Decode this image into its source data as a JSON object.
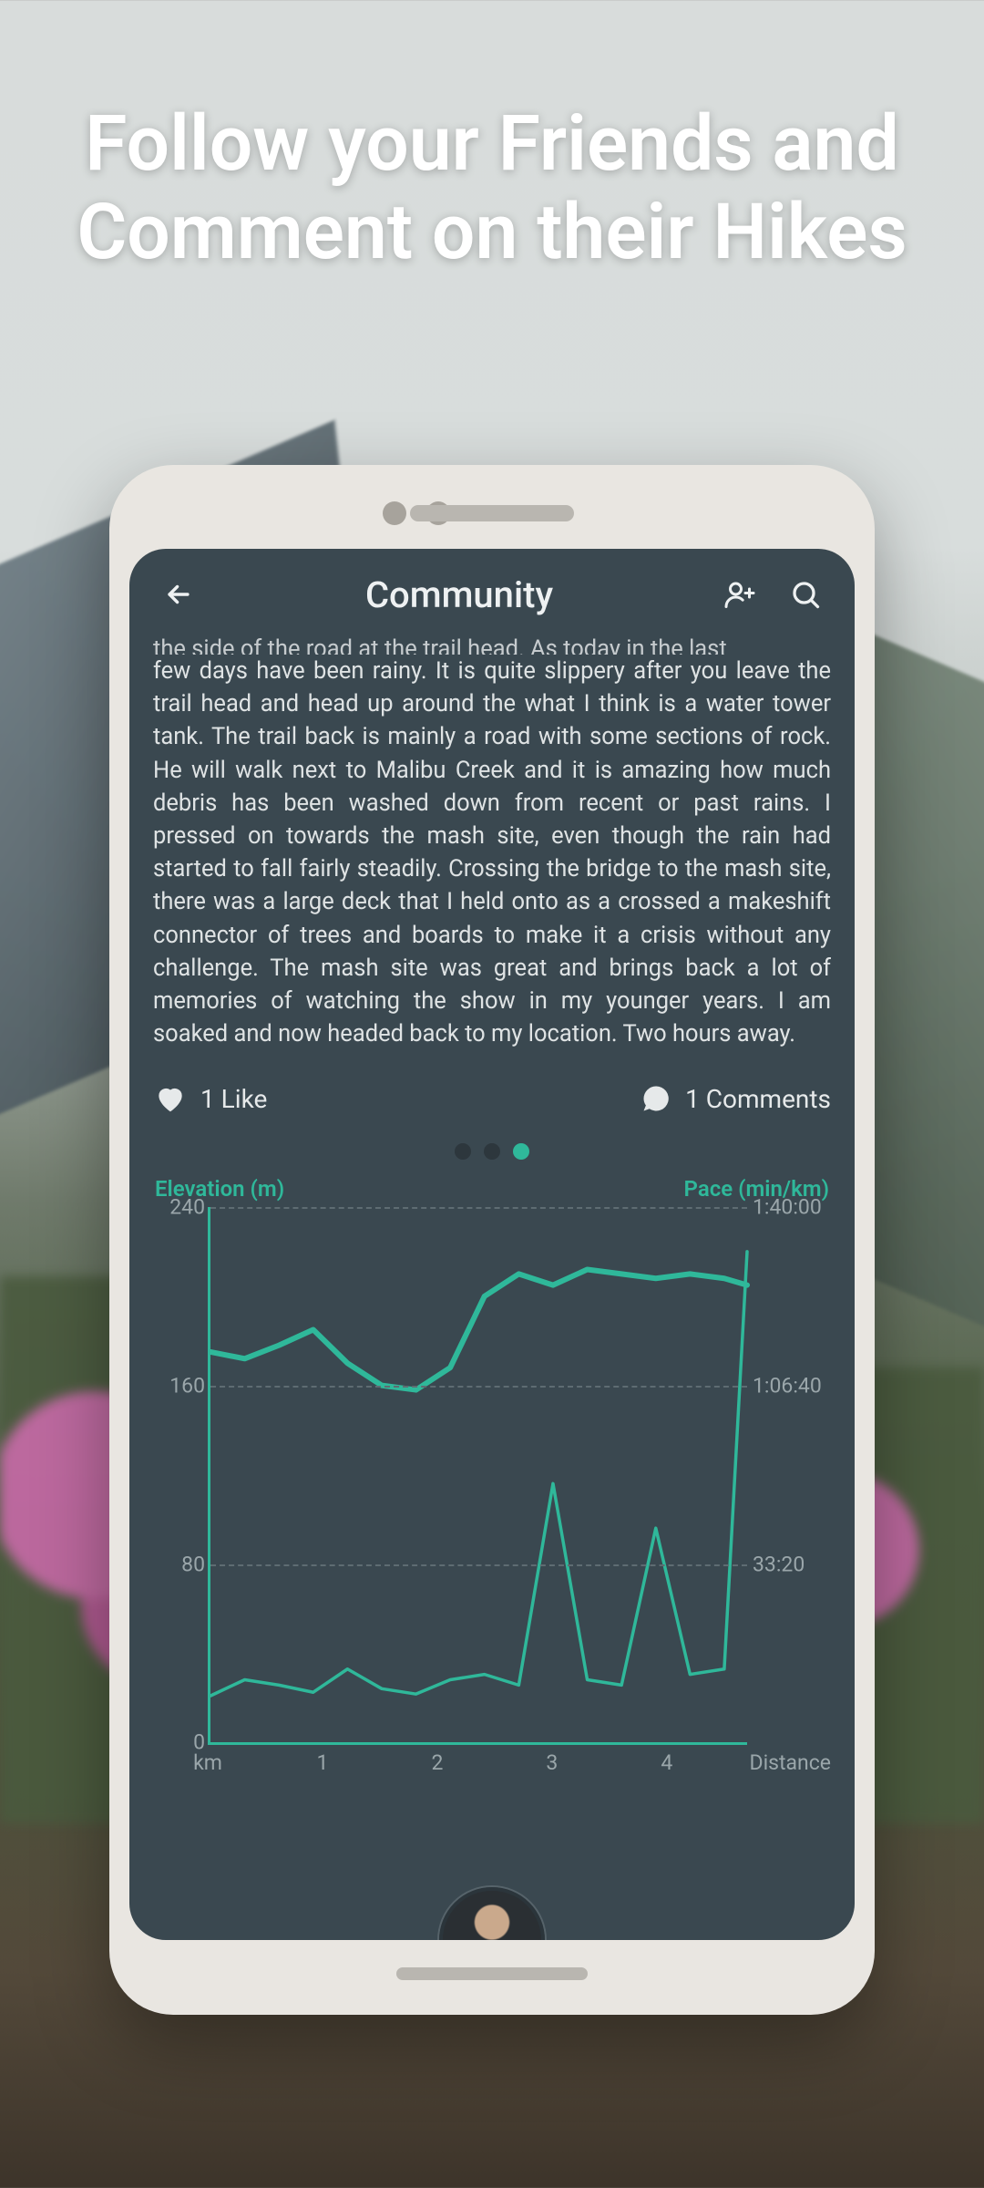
{
  "promo": {
    "headline": "Follow your Friends and Comment on their Hikes"
  },
  "app": {
    "header": {
      "title": "Community",
      "back_icon": "arrow-left",
      "add_friend_icon": "user-plus",
      "search_icon": "magnify"
    },
    "post": {
      "text_clipped_top": "the side of the road at the trail head. As today in the last",
      "text": "few days have been rainy. It is quite slippery after you leave the trail head and head up around the what I think is a water tower tank. The trail back is mainly a road with some sections of rock. He will walk next to Malibu Creek and it is amazing how much debris has been washed down from recent or past rains. I pressed on towards the mash site, even though the rain had started to fall fairly steadily. Crossing the bridge to the mash site, there was a large deck that I held onto as a crossed a makeshift connector of trees and boards to make it a crisis without any challenge. The mash site was great and brings back a lot of memories of watching the show in my younger years. I am soaked and now headed back to my location. Two hours away.",
      "likes_label": "1 Like",
      "comments_label": "1 Comments"
    },
    "carousel": {
      "count": 3,
      "active_index": 2
    },
    "chart_labels": {
      "left_axis_title": "Elevation (m)",
      "right_axis_title": "Pace (min/km)",
      "x_unit": "km",
      "x_label": "Distance"
    }
  },
  "chart_data": {
    "type": "line",
    "x": [
      0,
      0.3,
      0.6,
      0.9,
      1.2,
      1.5,
      1.8,
      2.1,
      2.4,
      2.7,
      3.0,
      3.3,
      3.6,
      3.9,
      4.2,
      4.5,
      4.7
    ],
    "x_ticks": [
      1,
      2,
      3,
      4
    ],
    "x_unit": "km",
    "xlabel": "Distance",
    "left_axis": {
      "label": "Elevation (m)",
      "ylim": [
        0,
        240
      ],
      "ticks": [
        0,
        80,
        160,
        240
      ]
    },
    "right_axis": {
      "label": "Pace (min/km)",
      "ylim_seconds": [
        0,
        6000
      ],
      "tick_labels": [
        "33:20",
        "1:06:40",
        "1:40:00"
      ],
      "tick_seconds": [
        2000,
        4000,
        6000
      ]
    },
    "series": [
      {
        "name": "Elevation",
        "axis": "left",
        "values": [
          175,
          172,
          178,
          185,
          170,
          160,
          158,
          168,
          200,
          210,
          205,
          212,
          210,
          208,
          210,
          208,
          205
        ]
      },
      {
        "name": "Pace",
        "axis": "right",
        "values_seconds": [
          520,
          700,
          640,
          560,
          820,
          600,
          540,
          700,
          760,
          640,
          2900,
          700,
          640,
          2400,
          760,
          820,
          5500
        ]
      }
    ]
  }
}
